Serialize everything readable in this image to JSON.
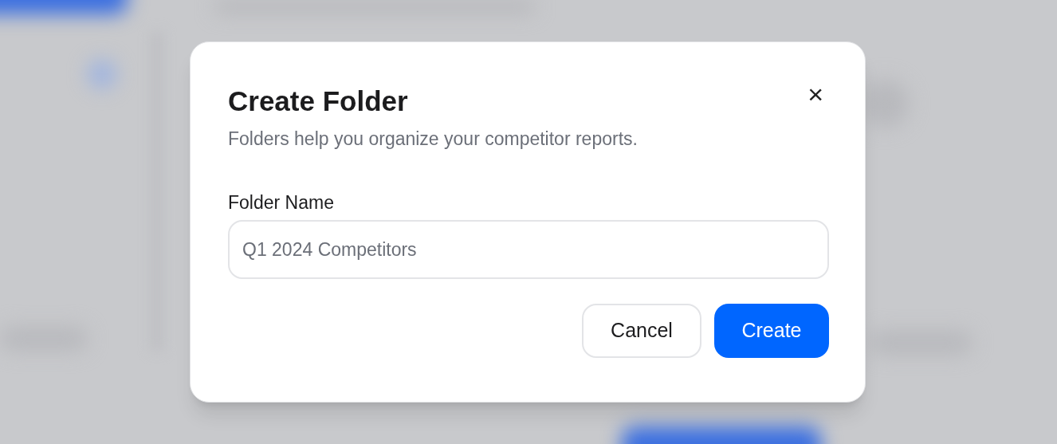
{
  "dialog": {
    "title": "Create Folder",
    "description": "Folders help you organize your competitor reports.",
    "close": "×",
    "field": {
      "label": "Folder Name",
      "placeholder": "Q1 2024 Competitors"
    },
    "buttons": [
      {
        "label": "Cancel",
        "kind": "secondary"
      },
      {
        "label": "Create",
        "kind": "primary"
      }
    ]
  }
}
